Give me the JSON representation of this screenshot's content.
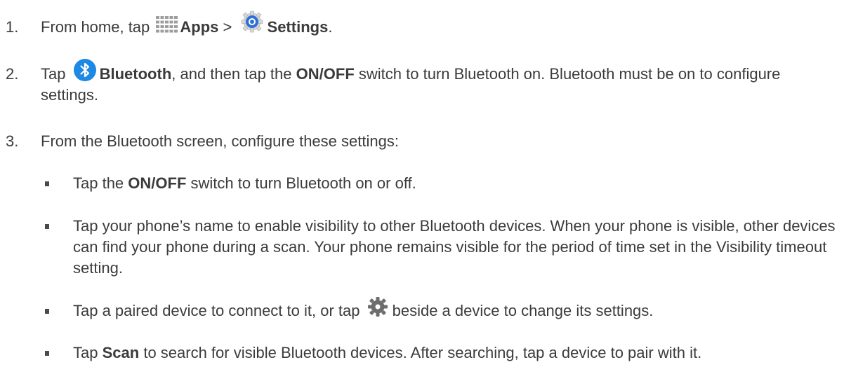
{
  "steps": [
    {
      "number": "1.",
      "text_a": "From home, tap",
      "bold_apps": "Apps",
      "text_b": ">",
      "bold_settings": "Settings",
      "text_c": "."
    },
    {
      "number": "2.",
      "text_a": "Tap",
      "bold_bluetooth": "Bluetooth",
      "text_b": ", and then tap the",
      "bold_onoff": "ON/OFF",
      "text_c": "switch to turn Bluetooth on. Bluetooth must be on to configure settings."
    },
    {
      "number": "3.",
      "text": "From the Bluetooth screen, configure these settings:"
    }
  ],
  "bullets": [
    {
      "text_a": "Tap the",
      "bold": "ON/OFF",
      "text_b": "switch to turn Bluetooth on or off."
    },
    {
      "text": "Tap your phone’s name to enable visibility to other Bluetooth devices. When your phone is visible, other devices can find your phone during a scan. Your phone remains visible for the period of time set in the Visibility timeout setting."
    },
    {
      "text_a": "Tap a paired device to connect to it, or tap",
      "text_b": "beside a device to change its settings."
    },
    {
      "text_a": "Tap",
      "bold": "Scan",
      "text_b": "to search for visible Bluetooth devices. After searching, tap a device to pair with it."
    }
  ],
  "icons": {
    "apps": "apps-grid-icon",
    "settings": "settings-icon",
    "bluetooth": "bluetooth-icon",
    "gear": "gear-icon"
  },
  "colors": {
    "text": "#3b3b3b",
    "bluetooth_blue": "#1e88e5",
    "settings_blue": "#2f6fd6",
    "apps_grid": "#9e9e9e",
    "gear": "#6d6d6d"
  }
}
